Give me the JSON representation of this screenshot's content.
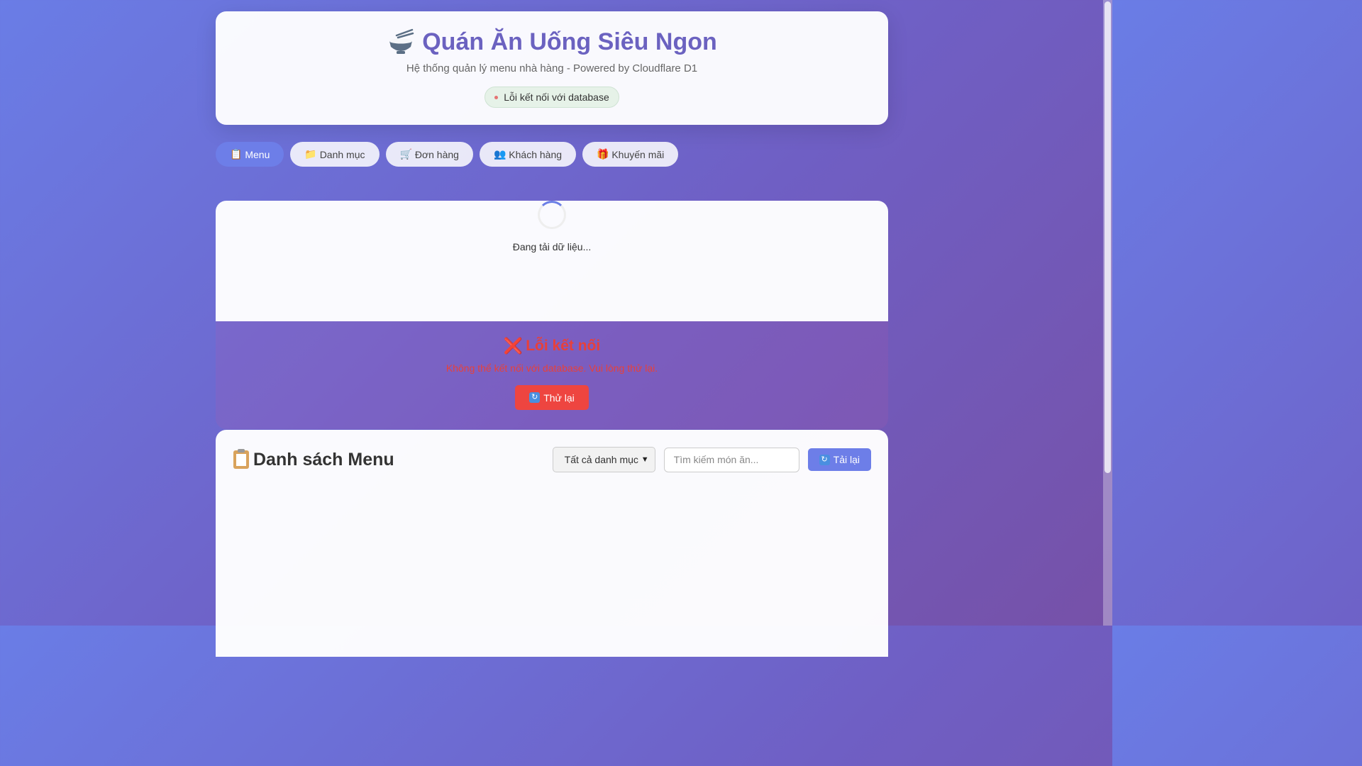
{
  "header": {
    "title": "Quán Ăn Uống Siêu Ngon",
    "title_icon": "noodle-bowl-icon",
    "subtitle": "Hệ thống quản lý menu nhà hàng - Powered by Cloudflare D1",
    "status_text": "Lỗi kết nối với database"
  },
  "tabs": [
    {
      "icon": "📋",
      "label": "Menu",
      "active": true
    },
    {
      "icon": "📁",
      "label": "Danh mục"
    },
    {
      "icon": "🛒",
      "label": "Đơn hàng"
    },
    {
      "icon": "👥",
      "label": "Khách hàng"
    },
    {
      "icon": "🎁",
      "label": "Khuyến mãi"
    }
  ],
  "loading": {
    "text": "Đang tải dữ liệu..."
  },
  "error": {
    "icon": "❌",
    "title": "Lỗi kết nối",
    "message": "Không thể kết nối với database. Vui lòng thử lại.",
    "retry_label": "Thử lại"
  },
  "menu": {
    "title": "Danh sách Menu",
    "category_select": "Tất cả danh mục",
    "search_placeholder": "Tìm kiếm món ăn...",
    "reload_label": "Tải lại"
  },
  "colors": {
    "accent": "#6d7ee8",
    "title": "#6b62c0",
    "error": "#e8403a",
    "retry": "#ee4540"
  }
}
